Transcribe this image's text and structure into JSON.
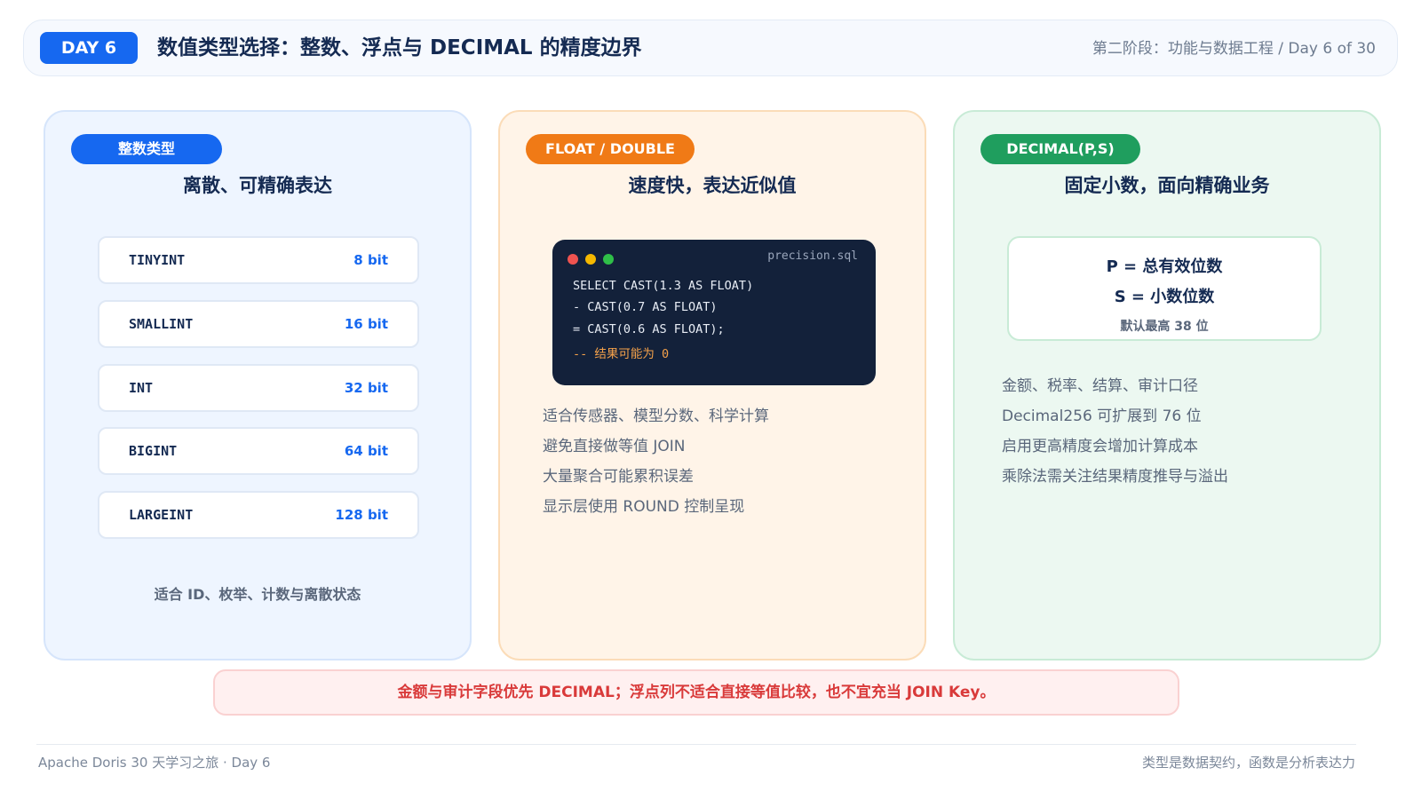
{
  "header": {
    "badge": "DAY 6",
    "title": "数值类型选择：整数、浮点与 DECIMAL 的精度边界",
    "subtitle": "第二阶段：功能与数据工程 / Day 6 of 30"
  },
  "cards": {
    "integer": {
      "pill": "整数类型",
      "title": "离散、可精确表达",
      "types": [
        {
          "name": "TINYINT",
          "bits": "8 bit"
        },
        {
          "name": "SMALLINT",
          "bits": "16 bit"
        },
        {
          "name": "INT",
          "bits": "32 bit"
        },
        {
          "name": "BIGINT",
          "bits": "64 bit"
        },
        {
          "name": "LARGEINT",
          "bits": "128 bit"
        }
      ],
      "footnote": "适合 ID、枚举、计数与离散状态"
    },
    "float": {
      "pill": "FLOAT / DOUBLE",
      "title": "速度快，表达近似值",
      "code": {
        "filename": "precision.sql",
        "lines": [
          "SELECT CAST(1.3 AS FLOAT)",
          "- CAST(0.7 AS FLOAT)",
          "= CAST(0.6 AS FLOAT);",
          "-- 结果可能为 0"
        ]
      },
      "bullets": [
        "适合传感器、模型分数、科学计算",
        "避免直接做等值 JOIN",
        "大量聚合可能累积误差",
        "显示层使用 ROUND 控制呈现"
      ]
    },
    "decimal": {
      "pill": "DECIMAL(P,S)",
      "title": "固定小数，面向精确业务",
      "formula": {
        "p": "P = 总有效位数",
        "s": "S = 小数位数",
        "note": "默认最高 38 位"
      },
      "bullets": [
        "金额、税率、结算、审计口径",
        "Decimal256 可扩展到 76 位",
        "启用更高精度会增加计算成本",
        "乘除法需关注结果精度推导与溢出"
      ]
    }
  },
  "warning": "金额与审计字段优先 DECIMAL；浮点列不适合直接等值比较，也不宜充当 JOIN Key。",
  "footer": {
    "left": "Apache Doris 30 天学习之旅 · Day 6",
    "right": "类型是数据契约，函数是分析表达力"
  }
}
